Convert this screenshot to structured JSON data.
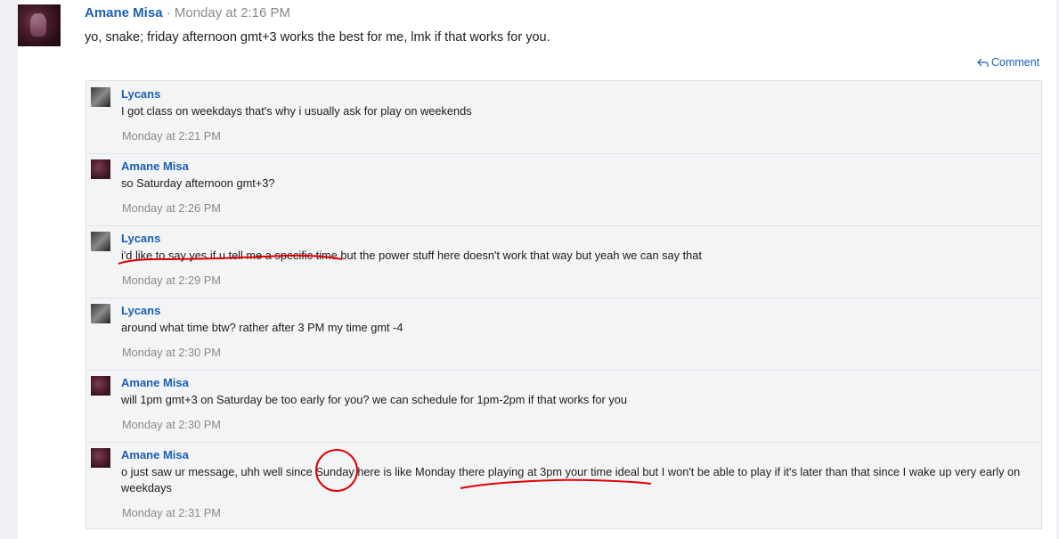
{
  "post": {
    "author": "Amane Misa",
    "meta": " · Monday at 2:16 PM",
    "body": "yo, snake; friday afternoon gmt+3 works the best for me, lmk if that works for you.",
    "comment_label": "Comment",
    "comment_icon": "reply-arrow-icon"
  },
  "replies": [
    {
      "author": "Lycans",
      "text": "I got class on weekdays that's why i usually ask for play on weekends",
      "time": "Monday at 2:21 PM"
    },
    {
      "author": "Amane Misa",
      "text": "so Saturday afternoon gmt+3?",
      "time": "Monday at 2:26 PM"
    },
    {
      "author": "Lycans",
      "text": "i'd like to say yes if u tell me a specific time but the power stuff here doesn't work that way but yeah we can say that",
      "time": "Monday at 2:29 PM"
    },
    {
      "author": "Lycans",
      "text": "around what time btw? rather after 3 PM my time gmt -4",
      "time": "Monday at 2:30 PM"
    },
    {
      "author": "Amane Misa",
      "text": "will 1pm gmt+3 on Saturday be too early for you? we can schedule for 1pm-2pm if that works for you",
      "time": "Monday at 2:30 PM"
    },
    {
      "author": "Amane Misa",
      "text": "o just saw ur message, uhh well since Sunday here is like Monday there playing at 3pm your time ideal but I won't be able to play if it's later than that since I wake up very early on weekdays",
      "time": "Monday at 2:31 PM"
    }
  ],
  "colors": {
    "link": "#1a5fb4",
    "meta": "#8a8a8a",
    "annotation": "#e00000"
  }
}
